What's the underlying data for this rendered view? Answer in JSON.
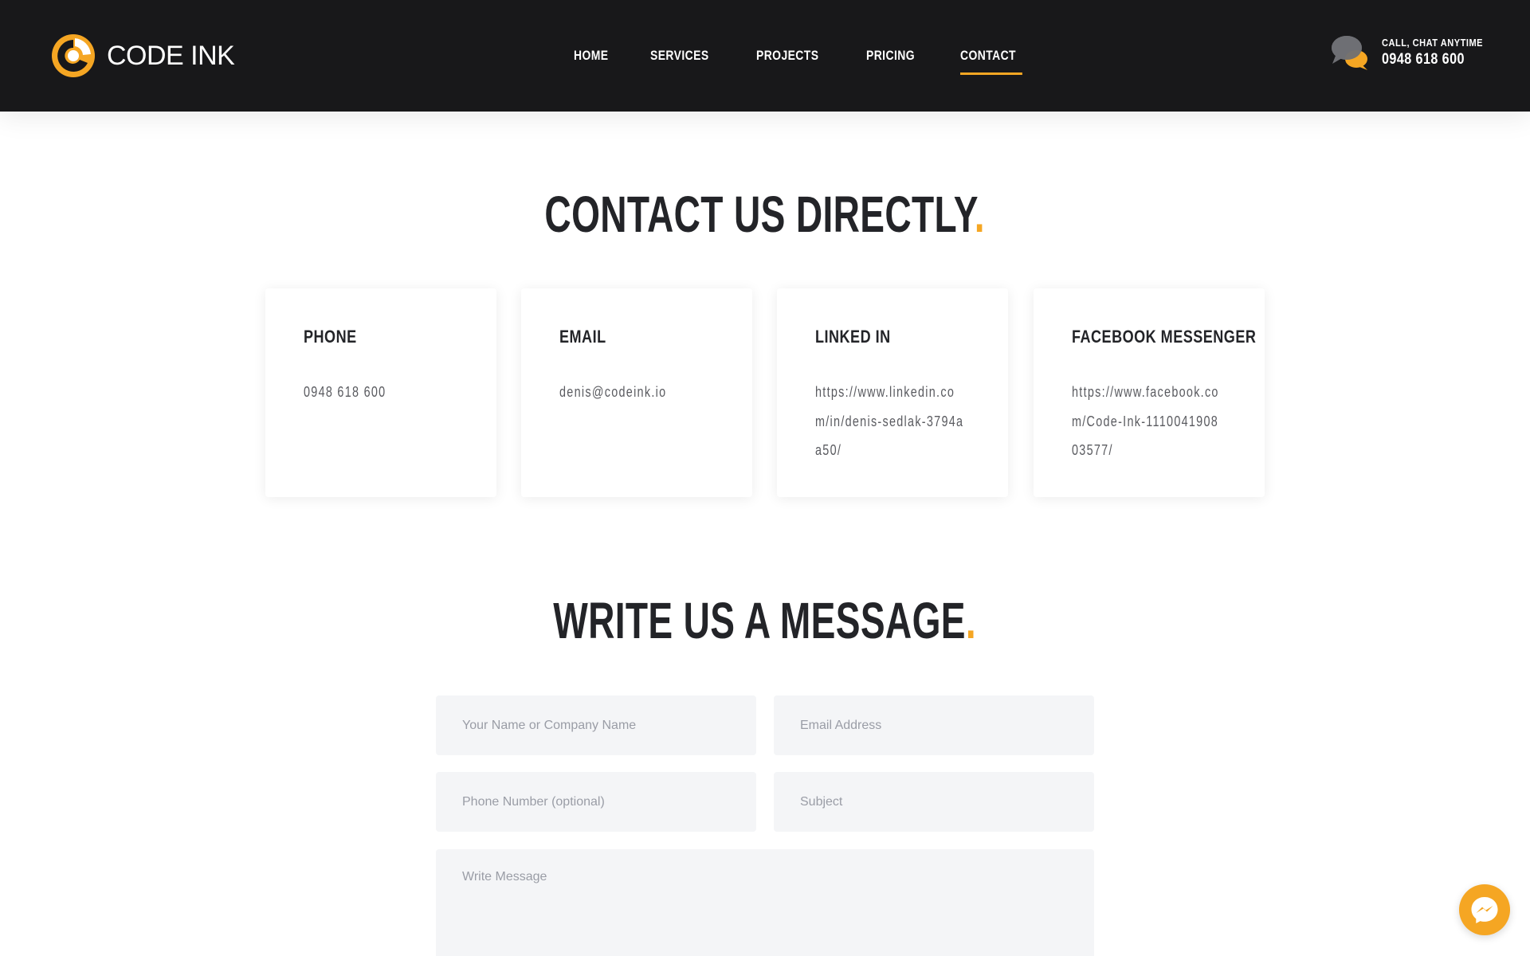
{
  "brand": {
    "name": "CODE INK",
    "accent_color": "#f5a623"
  },
  "nav": {
    "items": [
      {
        "label": "HOME"
      },
      {
        "label": "SERVICES"
      },
      {
        "label": "PROJECTS"
      },
      {
        "label": "PRICING"
      },
      {
        "label": "CONTACT",
        "active": true
      }
    ]
  },
  "header_contact": {
    "label": "CALL, CHAT ANYTIME",
    "phone": "0948 618 600",
    "icon": "chat-bubbles-icon"
  },
  "contact_section": {
    "title": "CONTACT US DIRECTLY",
    "dot": ".",
    "cards": [
      {
        "title": "PHONE",
        "value": "0948 618 600"
      },
      {
        "title": "EMAIL",
        "value": "denis@codeink.io"
      },
      {
        "title": "LINKED IN",
        "value": "https://www.linkedin.com/in/denis-sedlak-3794aa50/"
      },
      {
        "title": "FACEBOOK MESSENGER",
        "value": "https://www.facebook.com/Code-Ink-111004190803577/"
      }
    ]
  },
  "message_section": {
    "title": "WRITE US A MESSAGE",
    "dot": ".",
    "fields": {
      "name_placeholder": "Your Name or Company Name",
      "email_placeholder": "Email Address",
      "phone_placeholder": "Phone Number (optional)",
      "subject_placeholder": "Subject",
      "message_placeholder": "Write Message"
    }
  },
  "floating_button": {
    "icon": "messenger-icon"
  }
}
